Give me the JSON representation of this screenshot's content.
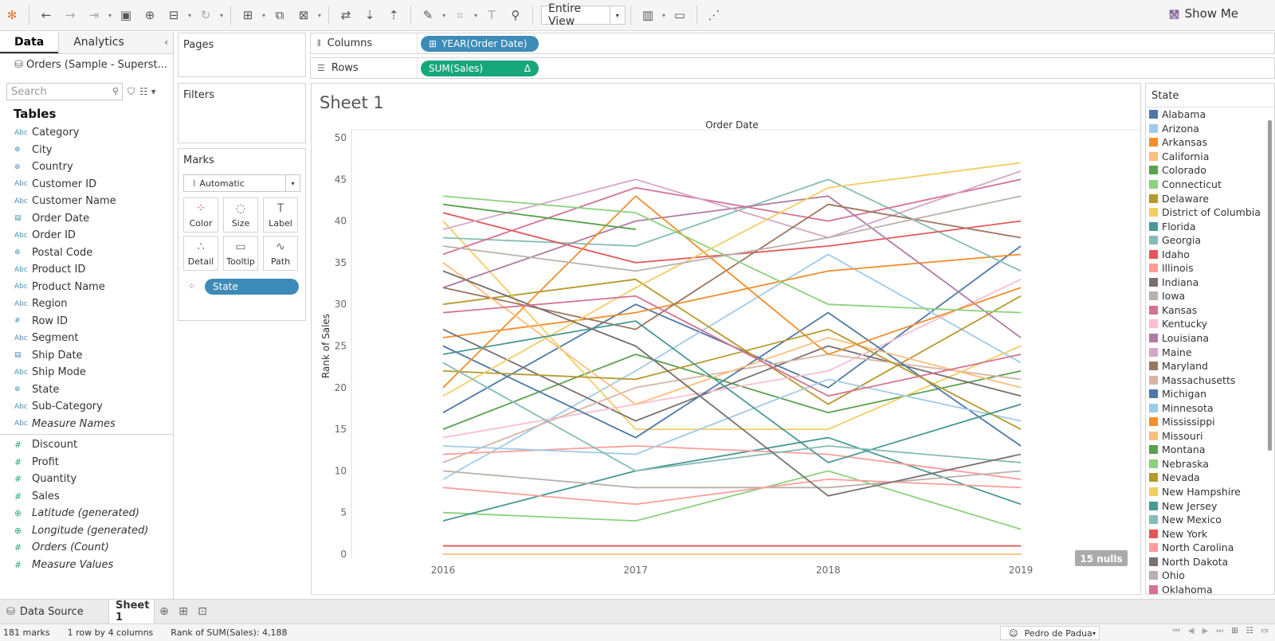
{
  "toolbar": {
    "view_label": "Entire View",
    "show_me": "Show Me"
  },
  "datapane": {
    "tab_data": "Data",
    "tab_analytics": "Analytics",
    "datasource": "Orders (Sample - Superst...",
    "search_placeholder": "Search",
    "tables_heading": "Tables",
    "dimensions": [
      {
        "name": "Category",
        "type": "Abc"
      },
      {
        "name": "City",
        "type": "geo"
      },
      {
        "name": "Country",
        "type": "geo"
      },
      {
        "name": "Customer ID",
        "type": "Abc"
      },
      {
        "name": "Customer Name",
        "type": "Abc"
      },
      {
        "name": "Order Date",
        "type": "date"
      },
      {
        "name": "Order ID",
        "type": "Abc"
      },
      {
        "name": "Postal Code",
        "type": "geo"
      },
      {
        "name": "Product ID",
        "type": "Abc"
      },
      {
        "name": "Product Name",
        "type": "Abc"
      },
      {
        "name": "Region",
        "type": "Abc"
      },
      {
        "name": "Row ID",
        "type": "num"
      },
      {
        "name": "Segment",
        "type": "Abc"
      },
      {
        "name": "Ship Date",
        "type": "date"
      },
      {
        "name": "Ship Mode",
        "type": "Abc"
      },
      {
        "name": "State",
        "type": "geo"
      },
      {
        "name": "Sub-Category",
        "type": "Abc"
      },
      {
        "name": "Measure Names",
        "type": "Abc",
        "italic": true
      }
    ],
    "measures": [
      {
        "name": "Discount",
        "type": "num"
      },
      {
        "name": "Profit",
        "type": "num"
      },
      {
        "name": "Quantity",
        "type": "num"
      },
      {
        "name": "Sales",
        "type": "num"
      },
      {
        "name": "Latitude (generated)",
        "type": "geo",
        "italic": true
      },
      {
        "name": "Longitude (generated)",
        "type": "geo",
        "italic": true
      },
      {
        "name": "Orders (Count)",
        "type": "num",
        "italic": true
      },
      {
        "name": "Measure Values",
        "type": "num",
        "italic": true
      }
    ]
  },
  "shelves": {
    "pages": "Pages",
    "filters": "Filters",
    "marks": "Marks",
    "mark_type": "Automatic",
    "mark_buttons": [
      "Color",
      "Size",
      "Label",
      "Detail",
      "Tooltip",
      "Path"
    ],
    "state_pill": "State",
    "columns_label": "Columns",
    "rows_label": "Rows",
    "columns_pill": "YEAR(Order Date)",
    "rows_pill": "SUM(Sales)",
    "rows_pill_delta": "Δ"
  },
  "sheet": {
    "title": "Sheet 1",
    "nulls_badge": "15 nulls"
  },
  "chart_data": {
    "type": "line",
    "title": "Order Date",
    "xlabel": "",
    "ylabel": "Rank of Sales",
    "x": [
      "2016",
      "2017",
      "2018",
      "2019"
    ],
    "ylim": [
      0,
      50
    ],
    "yticks": [
      0,
      5,
      10,
      15,
      20,
      25,
      30,
      35,
      40,
      45,
      50
    ],
    "grid": false,
    "series": [
      {
        "name": "Alabama",
        "color": "#4e79a7",
        "values": [
          17,
          30,
          20,
          37
        ]
      },
      {
        "name": "Arizona",
        "color": "#a0cbe8",
        "values": [
          9,
          22,
          36,
          23
        ]
      },
      {
        "name": "Arkansas",
        "color": "#f28e2b",
        "values": [
          26,
          29,
          34,
          36
        ]
      },
      {
        "name": "California",
        "color": "#ffbe7d",
        "values": [
          0,
          0,
          0,
          0
        ]
      },
      {
        "name": "Colorado",
        "color": "#59a14f",
        "values": [
          15,
          24,
          17,
          22
        ]
      },
      {
        "name": "Connecticut",
        "color": "#8cd17d",
        "values": [
          5,
          4,
          10,
          3
        ]
      },
      {
        "name": "Delaware",
        "color": "#b6992d",
        "values": [
          30,
          33,
          18,
          31
        ]
      },
      {
        "name": "District of Columbia",
        "color": "#f1ce63",
        "values": [
          40,
          15,
          15,
          25
        ]
      },
      {
        "name": "Florida",
        "color": "#499894",
        "values": [
          4,
          10,
          14,
          6
        ]
      },
      {
        "name": "Georgia",
        "color": "#86bcb6",
        "values": [
          38,
          37,
          45,
          34
        ]
      },
      {
        "name": "Idaho",
        "color": "#e15759",
        "values": [
          41,
          35,
          37,
          40
        ]
      },
      {
        "name": "Illinois",
        "color": "#ff9d9a",
        "values": [
          12,
          13,
          12,
          9
        ]
      },
      {
        "name": "Indiana",
        "color": "#79706e",
        "values": [
          27,
          16,
          25,
          19
        ]
      },
      {
        "name": "Iowa",
        "color": "#bab0ac",
        "values": [
          10,
          8,
          8,
          10
        ]
      },
      {
        "name": "Kansas",
        "color": "#d37295",
        "values": [
          36,
          44,
          40,
          45
        ]
      },
      {
        "name": "Kentucky",
        "color": "#fabfd2",
        "values": [
          14,
          18,
          22,
          33
        ]
      },
      {
        "name": "Louisiana",
        "color": "#b07aa1",
        "values": [
          32,
          40,
          43,
          26
        ]
      },
      {
        "name": "Maine",
        "color": "#d4a6c8",
        "values": [
          39,
          45,
          38,
          46
        ]
      },
      {
        "name": "Maryland",
        "color": "#9d7660",
        "values": [
          32,
          27,
          42,
          38
        ]
      },
      {
        "name": "Massachusetts",
        "color": "#d7b5a6",
        "values": [
          11,
          20,
          24,
          21
        ]
      },
      {
        "name": "Michigan",
        "color": "#4e79a7",
        "values": [
          25,
          14,
          29,
          13
        ]
      },
      {
        "name": "Minnesota",
        "color": "#a0cbe8",
        "values": [
          13,
          12,
          21,
          16
        ]
      },
      {
        "name": "Mississippi",
        "color": "#f28e2b",
        "values": [
          20,
          43,
          24,
          32
        ]
      },
      {
        "name": "Missouri",
        "color": "#ffbe7d",
        "values": [
          35,
          18,
          26,
          20
        ]
      },
      {
        "name": "Montana",
        "color": "#59a14f",
        "values": [
          42,
          39,
          null,
          null
        ]
      },
      {
        "name": "Nebraska",
        "color": "#8cd17d",
        "values": [
          43,
          41,
          30,
          29
        ]
      },
      {
        "name": "Nevada",
        "color": "#b6992d",
        "values": [
          22,
          21,
          27,
          15
        ]
      },
      {
        "name": "New Hampshire",
        "color": "#f1ce63",
        "values": [
          19,
          32,
          44,
          47
        ]
      },
      {
        "name": "New Jersey",
        "color": "#499894",
        "values": [
          24,
          28,
          11,
          18
        ]
      },
      {
        "name": "New Mexico",
        "color": "#86bcb6",
        "values": [
          23,
          10,
          13,
          11
        ]
      },
      {
        "name": "New York",
        "color": "#e15759",
        "values": [
          1,
          1,
          1,
          1
        ]
      },
      {
        "name": "North Carolina",
        "color": "#ff9d9a",
        "values": [
          8,
          6,
          9,
          8
        ]
      },
      {
        "name": "North Dakota",
        "color": "#79706e",
        "values": [
          34,
          25,
          7,
          12
        ]
      },
      {
        "name": "Ohio",
        "color": "#bab0ac",
        "values": [
          37,
          34,
          38,
          43
        ]
      },
      {
        "name": "Oklahoma",
        "color": "#d37295",
        "values": [
          29,
          31,
          19,
          24
        ]
      }
    ]
  },
  "legend": {
    "title": "State"
  },
  "tabs": {
    "data_source": "Data Source",
    "sheet1": "Sheet 1"
  },
  "status": {
    "marks": "181 marks",
    "rows_cols": "1 row by 4 columns",
    "rank": "Rank of SUM(Sales): 4,188",
    "user": "Pedro de Padua"
  }
}
